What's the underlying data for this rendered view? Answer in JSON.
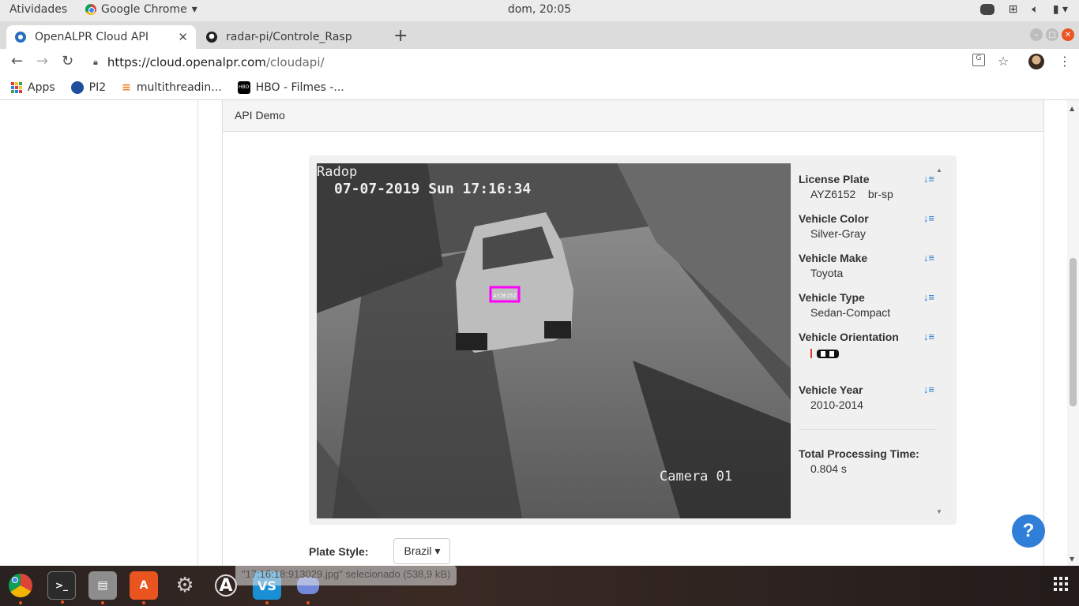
{
  "topbar": {
    "activities": "Atividades",
    "app_name": "Google Chrome",
    "clock": "dom, 20:05"
  },
  "tabs": [
    {
      "title": "OpenALPR Cloud API",
      "active": true
    },
    {
      "title": "radar-pi/Controle_Rasp",
      "active": false
    }
  ],
  "address": {
    "host": "https://cloud.openalpr.com",
    "path": "/cloudapi/"
  },
  "bookmarks": [
    {
      "label": "Apps",
      "icon": "apps-grid-icon"
    },
    {
      "label": "PI2",
      "icon": "drs-icon"
    },
    {
      "label": "multithreadin...",
      "icon": "stackoverflow-icon"
    },
    {
      "label": "HBO - Filmes -...",
      "icon": "hbo-icon"
    }
  ],
  "panel": {
    "heading": "API Demo"
  },
  "photo": {
    "overlay_brand": "Radop",
    "timestamp": "07-07-2019 Sun 17:16:34",
    "camera": "Camera 01",
    "plate_text": "AYZ6152",
    "plate_box_color": "#ff00ff"
  },
  "results": {
    "license_plate_label": "License Plate",
    "license_plate_value": "AYZ6152",
    "license_plate_region": "br-sp",
    "color_label": "Vehicle Color",
    "color_value": "Silver-Gray",
    "make_label": "Vehicle Make",
    "make_value": "Toyota",
    "type_label": "Vehicle Type",
    "type_value": "Sedan-Compact",
    "orientation_label": "Vehicle Orientation",
    "year_label": "Vehicle Year",
    "year_value": "2010-2014",
    "time_label": "Total Processing Time:",
    "time_value": "0.804 s"
  },
  "plate_style": {
    "label": "Plate Style:",
    "selected": "Brazil"
  },
  "help": "?",
  "download_status": "\"17:16:18:913029.jpg\" selecionado  (538,9 kB)",
  "accent": "#2f7ed8"
}
